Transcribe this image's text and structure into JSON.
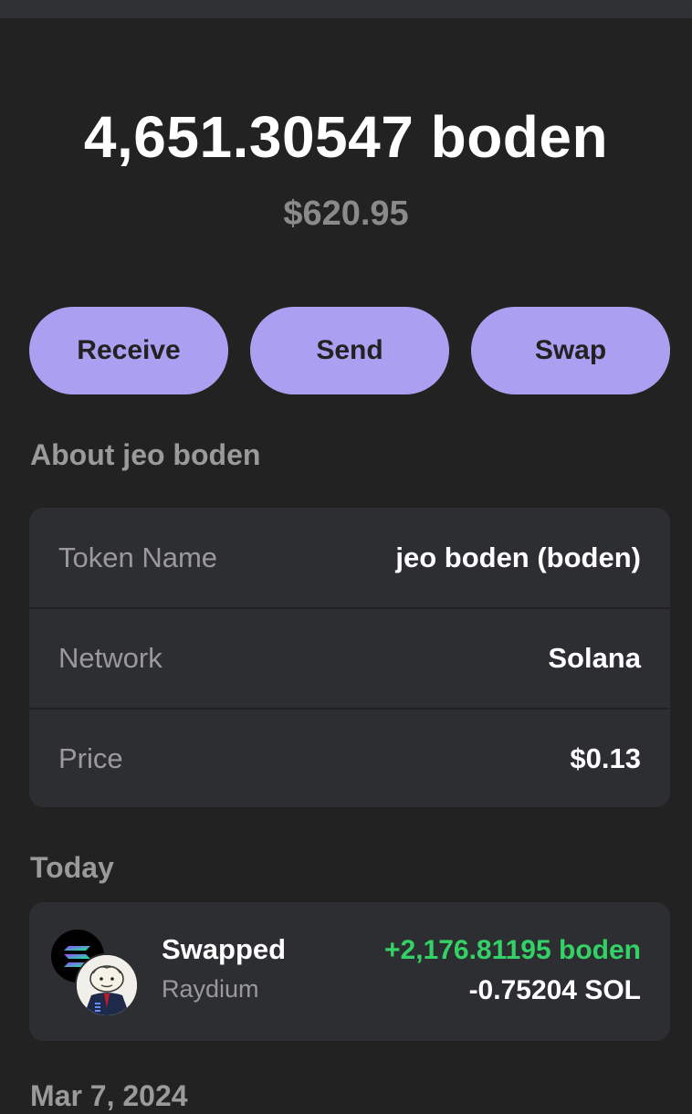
{
  "balance": {
    "amount": "4,651.30547 boden",
    "usd": "$620.95"
  },
  "actions": {
    "receive": "Receive",
    "send": "Send",
    "swap": "Swap"
  },
  "about": {
    "title": "About jeo boden",
    "rows": [
      {
        "label": "Token Name",
        "value": "jeo boden (boden)"
      },
      {
        "label": "Network",
        "value": "Solana"
      },
      {
        "label": "Price",
        "value": "$0.13"
      }
    ]
  },
  "activity": {
    "today_label": "Today",
    "transactions": [
      {
        "title": "Swapped",
        "source": "Raydium",
        "amount_in": "+2,176.81195 boden",
        "amount_out": "-0.75204 SOL",
        "icons": [
          "solana-icon",
          "boden-token-icon"
        ]
      }
    ],
    "next_date_label": "Mar 7, 2024"
  },
  "colors": {
    "background": "#222222",
    "card": "#2d2e32",
    "accent": "#ab9ff2",
    "positive": "#34d167",
    "muted": "#9a9a9a"
  }
}
